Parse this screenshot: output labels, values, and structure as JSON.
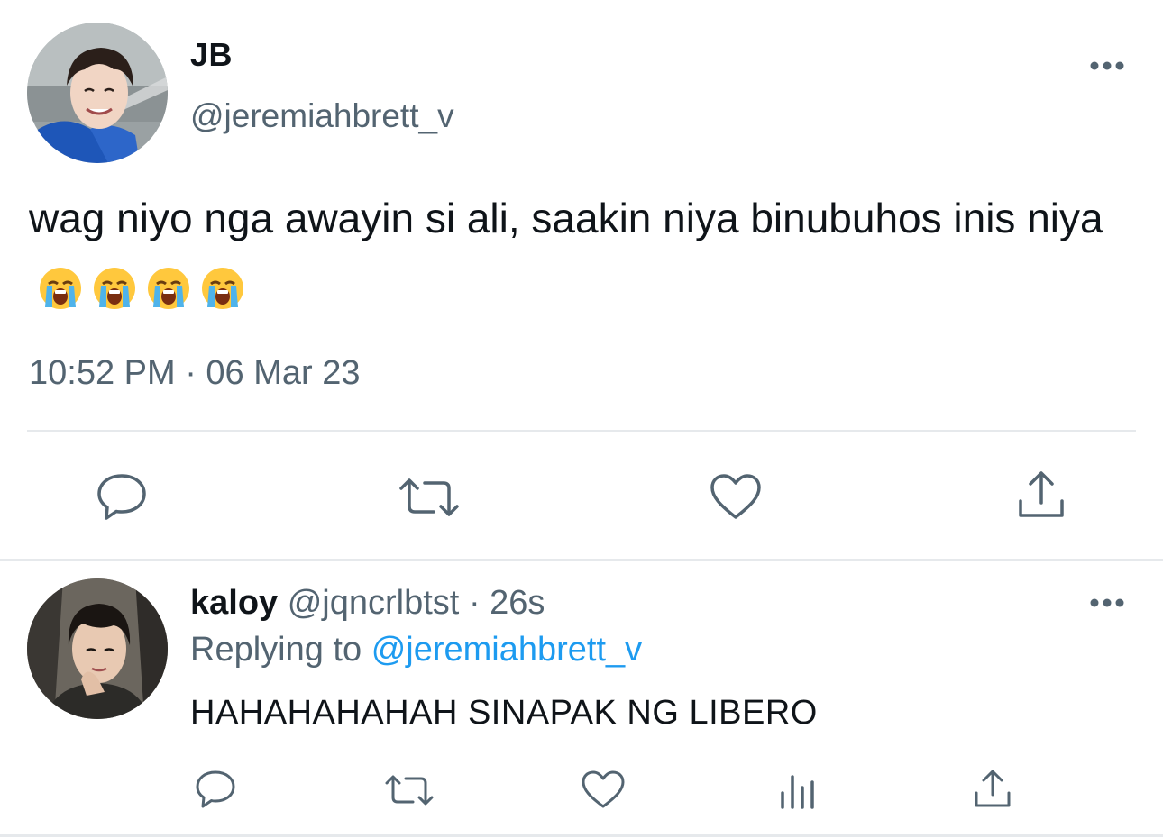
{
  "main_tweet": {
    "display_name": "JB",
    "handle": "@jeremiahbrett_v",
    "text": "wag niyo nga awayin si ali, saakin niya binubuhos inis niya",
    "emojis": [
      "loudly-crying-face-emoji",
      "loudly-crying-face-emoji",
      "loudly-crying-face-emoji",
      "loudly-crying-face-emoji"
    ],
    "timestamp": "10:52 PM · 06 Mar 23",
    "actions": [
      "reply-icon",
      "retweet-icon",
      "like-icon",
      "share-icon"
    ]
  },
  "reply_tweet": {
    "display_name": "kaloy",
    "handle": "@jqncrlbtst",
    "separator": "·",
    "time_ago": "26s",
    "replying_prefix": "Replying to",
    "replying_handle": "@jeremiahbrett_v",
    "text": "HAHAHAHAHAH SINAPAK NG LIBERO",
    "actions": [
      "reply-icon",
      "retweet-icon",
      "like-icon",
      "analytics-icon",
      "share-icon"
    ]
  },
  "colors": {
    "text_primary": "#0f1419",
    "text_secondary": "#536471",
    "link": "#1d9bf0",
    "icon": "#536471",
    "divider": "#e6e9ec"
  }
}
